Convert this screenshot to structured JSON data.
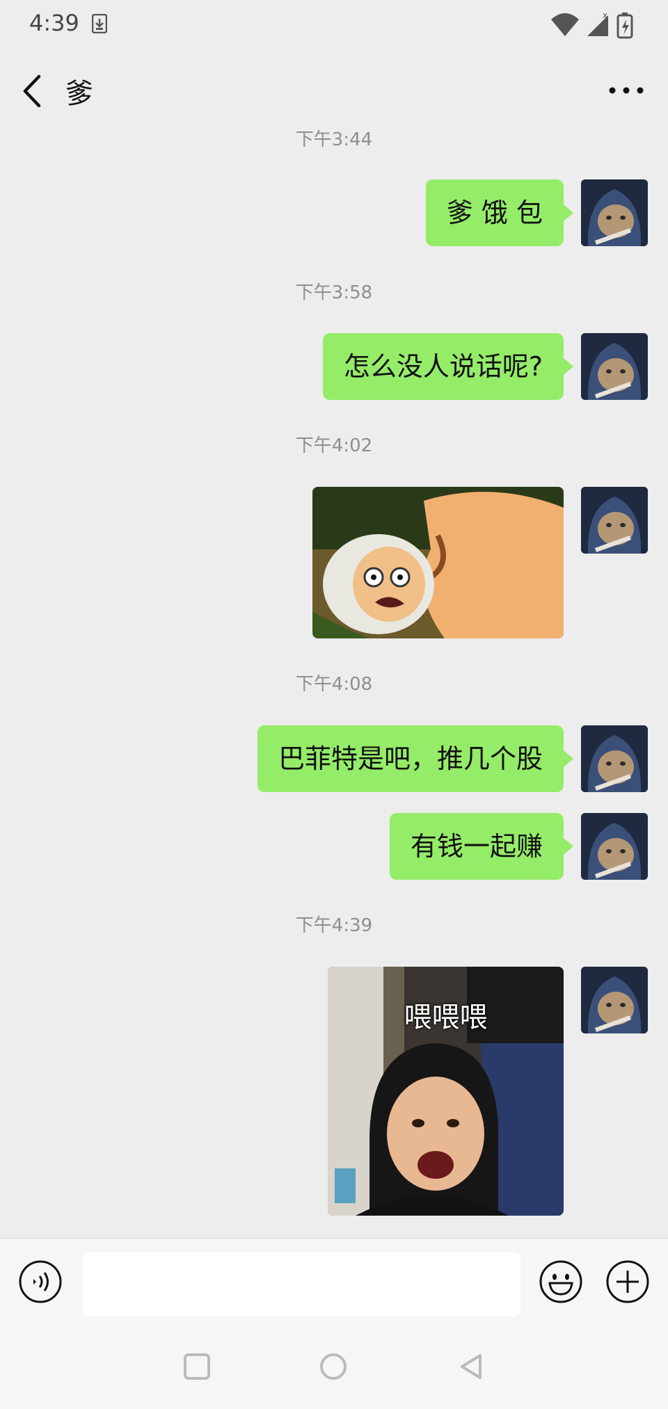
{
  "status_bar": {
    "time": "4:39",
    "icons": [
      "download-icon",
      "wifi-icon",
      "cellular-signal-icon",
      "battery-icon"
    ]
  },
  "header": {
    "back_icon": "chevron-left-icon",
    "title": "爹",
    "more_icon": "more-dots-icon"
  },
  "messages": [
    {
      "type": "timestamp",
      "text": "下午3:44"
    },
    {
      "type": "text",
      "sender": "me",
      "text": "爹 饿 包"
    },
    {
      "type": "timestamp",
      "text": "下午3:58"
    },
    {
      "type": "text",
      "sender": "me",
      "text": "怎么没人说话呢?"
    },
    {
      "type": "timestamp",
      "text": "下午4:02"
    },
    {
      "type": "image",
      "sender": "me",
      "description": "cartoon-sticker"
    },
    {
      "type": "timestamp",
      "text": "下午4:08"
    },
    {
      "type": "text",
      "sender": "me",
      "text": "巴菲特是吧，推几个股"
    },
    {
      "type": "text",
      "sender": "me",
      "text": "有钱一起赚"
    },
    {
      "type": "timestamp",
      "text": "下午4:39"
    },
    {
      "type": "image",
      "sender": "me",
      "caption": "喂喂喂"
    }
  ],
  "input_bar": {
    "voice_icon": "voice-icon",
    "input_value": "",
    "emoji_icon": "emoji-icon",
    "plus_icon": "plus-icon"
  },
  "nav_bar": {
    "icons": [
      "recent-apps-icon",
      "home-icon",
      "back-icon"
    ]
  },
  "colors": {
    "background": "#ededed",
    "bubble": "#95ec69",
    "timestamp": "#8e8e8e"
  }
}
